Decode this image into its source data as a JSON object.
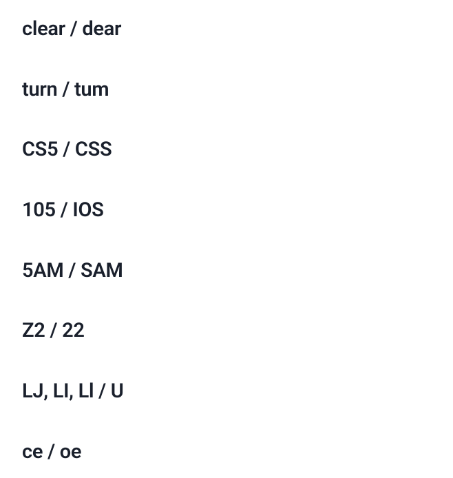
{
  "items": [
    "clear / dear",
    "turn / tum",
    "CS5 / CSS",
    "105 / IOS",
    "5AM / SAM",
    "Z2 / 22",
    "LJ, LI, Ll / U",
    "ce / oe"
  ]
}
